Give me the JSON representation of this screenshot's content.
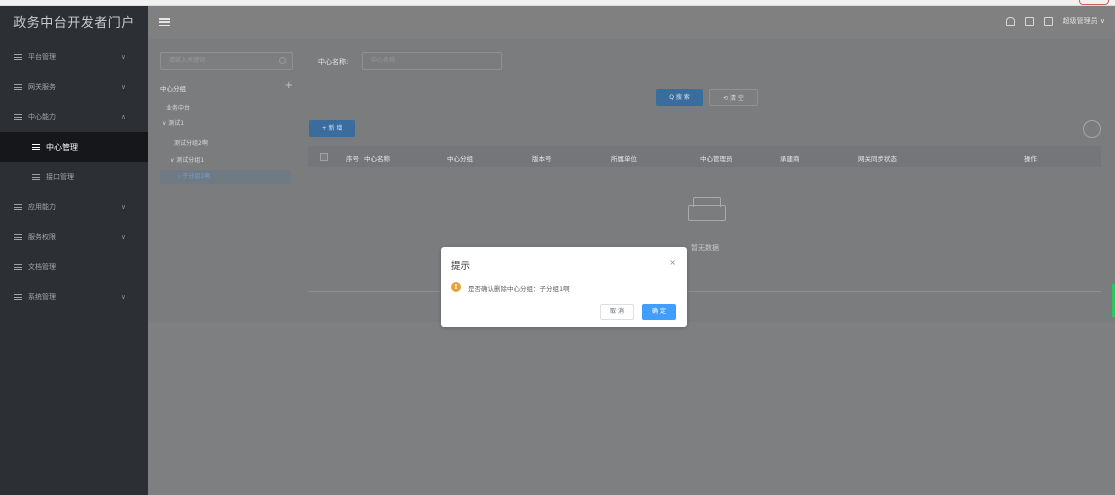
{
  "brand": {
    "title": "政务中台开发者门户"
  },
  "sidebar": {
    "items": [
      {
        "label": "平台管理",
        "chevron": "∨"
      },
      {
        "label": "网关服务",
        "chevron": "∨"
      },
      {
        "label": "中心能力",
        "chevron": "∧"
      },
      {
        "label": "中心管理"
      },
      {
        "label": "接口管理"
      },
      {
        "label": "应用能力",
        "chevron": "∨"
      },
      {
        "label": "服务权限",
        "chevron": "∨"
      },
      {
        "label": "文档管理"
      },
      {
        "label": "系统管理",
        "chevron": "∨"
      }
    ]
  },
  "header": {
    "user": "超级管理员",
    "user_chevron": "∨"
  },
  "tree": {
    "search_placeholder": "请输入关键词",
    "heading": "中心分组",
    "add": "+",
    "nodes": [
      {
        "label": "业务中台"
      },
      {
        "label": "∨ 测试1"
      },
      {
        "label": "测试分组2啊"
      },
      {
        "label": "∨ 测试分组1"
      },
      {
        "label": "› 子分组1啊"
      }
    ]
  },
  "query": {
    "label": "中心名称:",
    "placeholder": "中心名称",
    "search_btn": "Q 搜 索",
    "clear_btn": "⟲ 清 空",
    "add_btn": "+ 新 增"
  },
  "table": {
    "columns": [
      "序号",
      "中心名称",
      "中心分组",
      "版本号",
      "所属单位",
      "中心管理员",
      "承建商",
      "网关同步状态",
      "操作"
    ],
    "empty_text": "暂无数据"
  },
  "dialog": {
    "title": "提示",
    "close": "×",
    "icon": "!",
    "message": "是否确认删除中心分组：子分组1啊",
    "cancel": "取 消",
    "ok": "确 定"
  }
}
